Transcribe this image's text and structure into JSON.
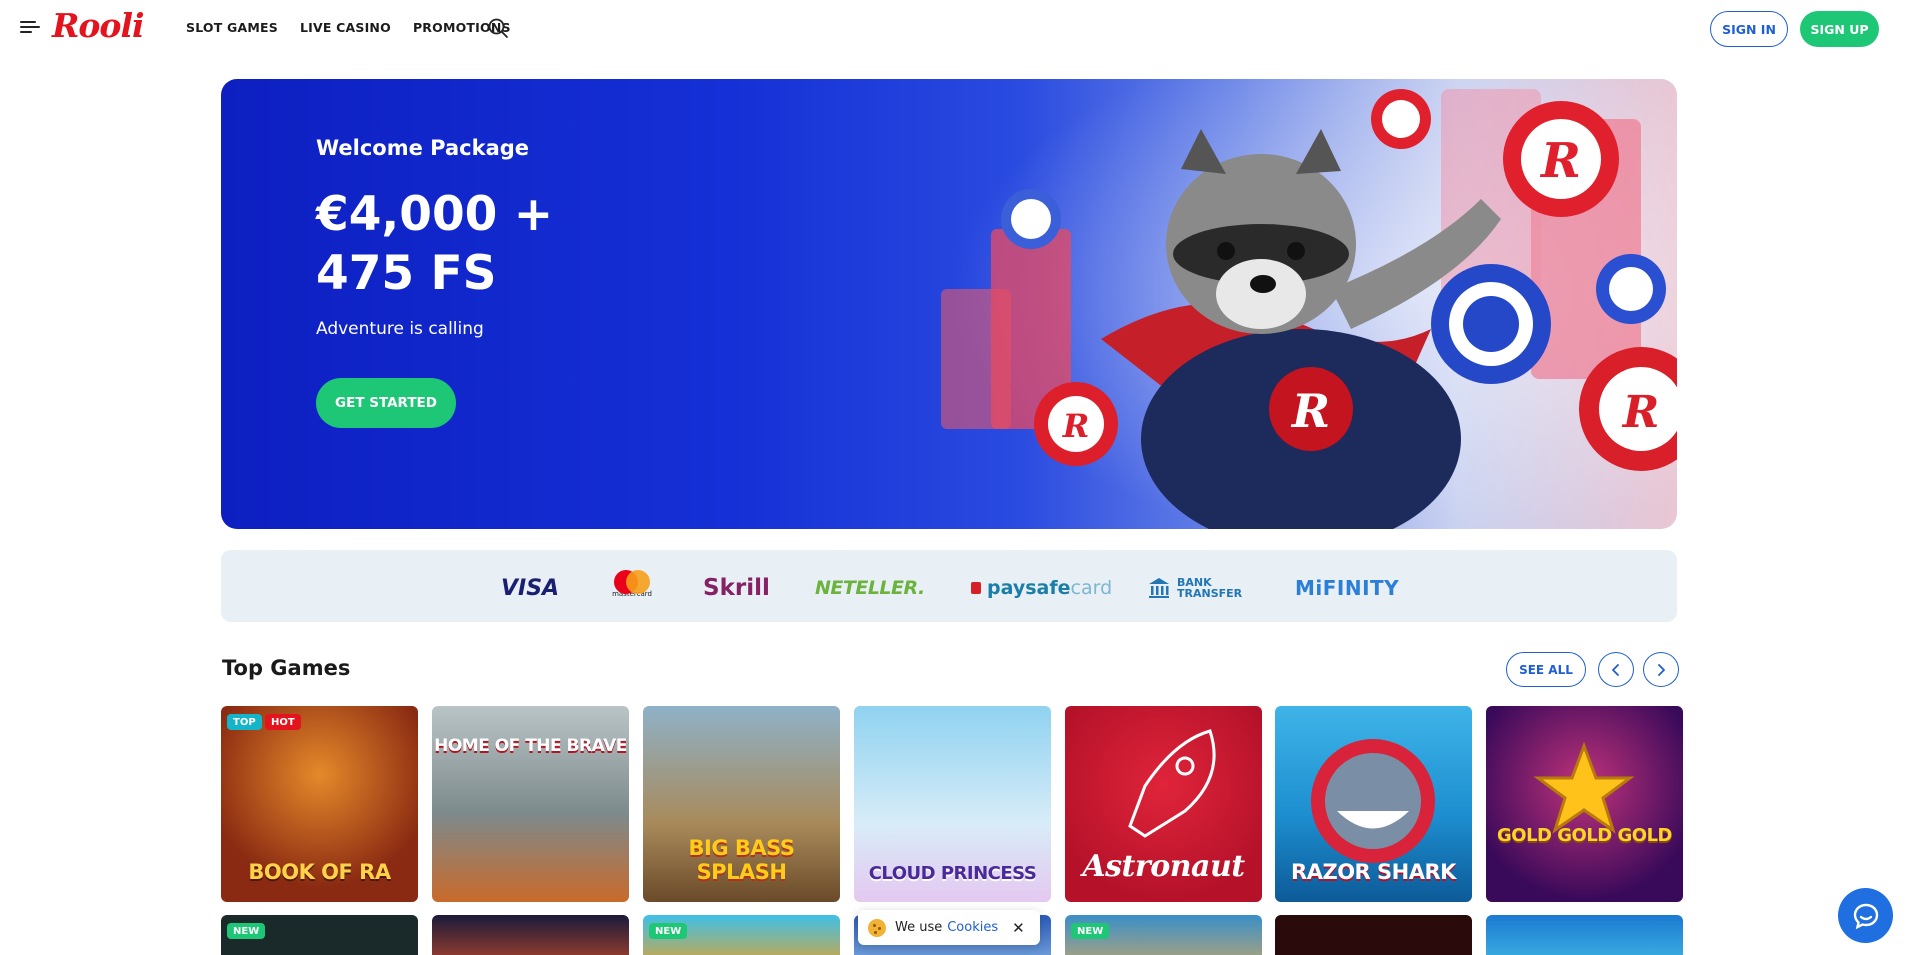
{
  "header": {
    "logo_text": "Rooli",
    "nav": [
      "SLOT GAMES",
      "LIVE CASINO",
      "PROMOTIONS"
    ],
    "sign_in": "SIGN IN",
    "sign_up": "SIGN UP"
  },
  "hero": {
    "eyebrow": "Welcome Package",
    "title": "€4,000 + 475 FS",
    "subtitle": "Adventure is calling",
    "cta": "GET STARTED"
  },
  "payments": {
    "visa": "VISA",
    "mastercard": "mastercard",
    "skrill": "Skrill",
    "neteller": "NETELLER.",
    "paysafe_bold": "paysafe",
    "paysafe_light": "card",
    "bank_line1": "BANK",
    "bank_line2": "TRANSFER",
    "mifinity": "MiFINITY"
  },
  "top_games": {
    "title": "Top Games",
    "see_all": "SEE ALL",
    "games": [
      {
        "name": "BOOK OF RA",
        "badges": [
          "TOP",
          "HOT"
        ],
        "bg": "#8a2a12"
      },
      {
        "name": "HOME OF THE BRAVE",
        "badges": [],
        "bg": "#7d8a8c"
      },
      {
        "name": "BIG BASS SPLASH",
        "badges": [],
        "bg": "#a88a5a"
      },
      {
        "name": "CLOUD PRINCESS",
        "badges": [],
        "bg": "#b8d6ee"
      },
      {
        "name": "Astronaut",
        "badges": [],
        "bg": "#c8172e"
      },
      {
        "name": "RAZOR SHARK",
        "badges": [],
        "bg": "#1d8fd0"
      },
      {
        "name": "GOLD GOLD GOLD",
        "badges": [],
        "bg": "#5a1a7a"
      }
    ],
    "row2_badges": [
      "NEW",
      "",
      "NEW",
      "",
      "NEW",
      "",
      ""
    ]
  },
  "cookie": {
    "text": "We use",
    "link": "Cookies",
    "close": "✕"
  },
  "colors": {
    "brand_red": "#e4141e",
    "accent_green": "#1dc776",
    "accent_blue": "#1f5fd1"
  }
}
